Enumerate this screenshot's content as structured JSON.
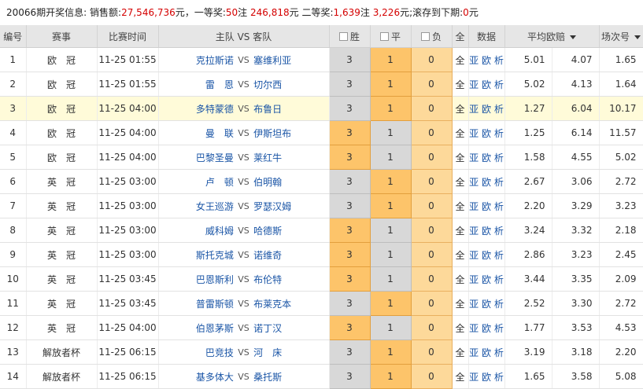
{
  "info": {
    "period": "20066期开奖信息:",
    "sales_label": "销售额:",
    "sales_value": "27,546,736",
    "unit_yuan": "元，",
    "first_label": "一等奖:",
    "first_count": "50",
    "zhu": "注",
    "first_amount": "246,818",
    "yuan": "元",
    "second_label": "二等奖:",
    "second_count": "1,639",
    "second_amount": "3,226",
    "rollover_label": "元;滚存到下期:",
    "rollover_value": "0",
    "rollover_unit": "元"
  },
  "headers": {
    "no": "编号",
    "league": "赛事",
    "time": "比赛时间",
    "teams": "主队 VS 客队",
    "win": "胜",
    "draw": "平",
    "loss": "负",
    "all": "全",
    "data": "数据",
    "avg_odds": "平均欧赔",
    "match_no": "场次号"
  },
  "vs": "VS",
  "quan": "全",
  "ya": "亚",
  "ou": "欧",
  "xi": "析",
  "rows": [
    {
      "no": "1",
      "league": "欧　冠",
      "time": "11-25 01:55",
      "home": "克拉斯诺",
      "away": "塞维利亚",
      "w": "3",
      "d": "1",
      "l": "0",
      "o1": "5.01",
      "o2": "4.07",
      "o3": "1.65"
    },
    {
      "no": "2",
      "league": "欧　冠",
      "time": "11-25 01:55",
      "home": "雷　恩",
      "away": "切尔西",
      "w": "3",
      "d": "1",
      "l": "0",
      "o1": "5.02",
      "o2": "4.13",
      "o3": "1.64"
    },
    {
      "no": "3",
      "league": "欧　冠",
      "time": "11-25 04:00",
      "home": "多特蒙德",
      "away": "布鲁日",
      "w": "3",
      "d": "1",
      "l": "0",
      "o1": "1.27",
      "o2": "6.04",
      "o3": "10.17"
    },
    {
      "no": "4",
      "league": "欧　冠",
      "time": "11-25 04:00",
      "home": "曼　联",
      "away": "伊斯坦布",
      "w": "3",
      "d": "1",
      "l": "0",
      "o1": "1.25",
      "o2": "6.14",
      "o3": "11.57"
    },
    {
      "no": "5",
      "league": "欧　冠",
      "time": "11-25 04:00",
      "home": "巴黎圣曼",
      "away": "莱红牛",
      "w": "3",
      "d": "1",
      "l": "0",
      "o1": "1.58",
      "o2": "4.55",
      "o3": "5.02"
    },
    {
      "no": "6",
      "league": "英　冠",
      "time": "11-25 03:00",
      "home": "卢　顿",
      "away": "伯明翰",
      "w": "3",
      "d": "1",
      "l": "0",
      "o1": "2.67",
      "o2": "3.06",
      "o3": "2.72"
    },
    {
      "no": "7",
      "league": "英　冠",
      "time": "11-25 03:00",
      "home": "女王巡游",
      "away": "罗瑟汉姆",
      "w": "3",
      "d": "1",
      "l": "0",
      "o1": "2.20",
      "o2": "3.29",
      "o3": "3.23"
    },
    {
      "no": "8",
      "league": "英　冠",
      "time": "11-25 03:00",
      "home": "威科姆",
      "away": "哈德斯",
      "w": "3",
      "d": "1",
      "l": "0",
      "o1": "3.24",
      "o2": "3.32",
      "o3": "2.18"
    },
    {
      "no": "9",
      "league": "英　冠",
      "time": "11-25 03:00",
      "home": "斯托克城",
      "away": "诺维奇",
      "w": "3",
      "d": "1",
      "l": "0",
      "o1": "2.86",
      "o2": "3.23",
      "o3": "2.45"
    },
    {
      "no": "10",
      "league": "英　冠",
      "time": "11-25 03:45",
      "home": "巴恩斯利",
      "away": "布伦特",
      "w": "3",
      "d": "1",
      "l": "0",
      "o1": "3.44",
      "o2": "3.35",
      "o3": "2.09"
    },
    {
      "no": "11",
      "league": "英　冠",
      "time": "11-25 03:45",
      "home": "普雷斯顿",
      "away": "布莱克本",
      "w": "3",
      "d": "1",
      "l": "0",
      "o1": "2.52",
      "o2": "3.30",
      "o3": "2.72"
    },
    {
      "no": "12",
      "league": "英　冠",
      "time": "11-25 04:00",
      "home": "伯恩茅斯",
      "away": "诺丁汉",
      "w": "3",
      "d": "1",
      "l": "0",
      "o1": "1.77",
      "o2": "3.53",
      "o3": "4.53"
    },
    {
      "no": "13",
      "league": "解放者杯",
      "time": "11-25 06:15",
      "home": "巴竞技",
      "away": "河　床",
      "w": "3",
      "d": "1",
      "l": "0",
      "o1": "3.19",
      "o2": "3.18",
      "o3": "2.20"
    },
    {
      "no": "14",
      "league": "解放者杯",
      "time": "11-25 06:15",
      "home": "基多体大",
      "away": "桑托斯",
      "w": "3",
      "d": "1",
      "l": "0",
      "o1": "1.65",
      "o2": "3.58",
      "o3": "5.08"
    }
  ]
}
